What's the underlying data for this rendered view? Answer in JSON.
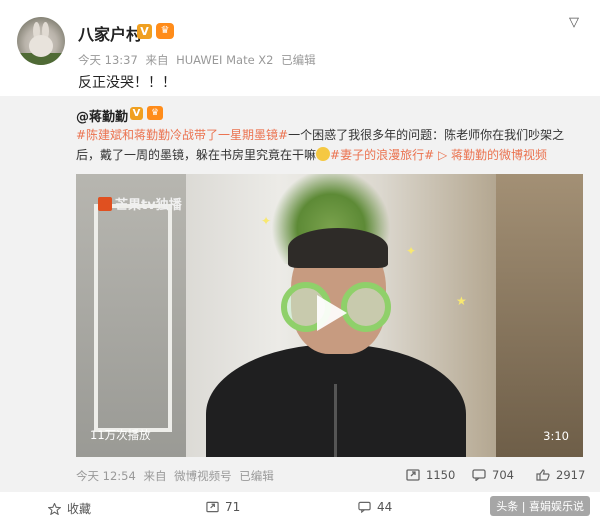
{
  "author": {
    "name": "八家户村",
    "verified_mark": "V"
  },
  "post": {
    "time": "今天 13:37",
    "source_prefix": "来自",
    "source": "HUAWEI Mate X2",
    "edited": "已编辑",
    "text": "反正没哭！！！"
  },
  "repost": {
    "author": "@蒋勤勤",
    "verified_mark": "V",
    "tag1": "#陈建斌和蒋勤勤冷战带了一星期墨镜#",
    "text_main": "一个困惑了我很多年的问题：陈老师你在我们吵架之后，戴了一周的墨镜，躲在书房里究竟在干嘛",
    "tag2": "#妻子的浪漫旅行#",
    "video_link": "蒋勤勤的微博视频",
    "video": {
      "logo": "芒果tv独播",
      "views": "11万次播放",
      "duration": "3:10"
    },
    "time": "今天 12:54",
    "source_prefix": "来自",
    "source": "微博视频号",
    "edited": "已编辑",
    "reposts": "1150",
    "comments": "704",
    "likes": "2917"
  },
  "actions": {
    "collect": "收藏",
    "repost_count": "71",
    "comment_count": "44"
  },
  "watermark": "头条 | 喜娟娱乐说",
  "icons": [
    "chevron-down-icon",
    "repost-icon",
    "comment-icon",
    "like-icon",
    "star-icon",
    "play-icon",
    "link-video-icon"
  ]
}
